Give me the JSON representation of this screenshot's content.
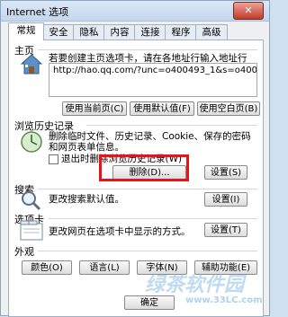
{
  "window": {
    "title": "Internet 选项",
    "close_label": "✕"
  },
  "tabs": [
    "常规",
    "安全",
    "隐私",
    "内容",
    "连接",
    "程序",
    "高级"
  ],
  "homepage": {
    "section_title": "主页",
    "description": "若要创建主页选项卡，请在各地址行输入地址行(R)。",
    "url": "http://hao.qq.com/?unc=o400493_1&s=o40049",
    "buttons": {
      "use_current": "使用当前页(C)",
      "use_default": "使用默认值(F)",
      "use_blank": "使用空白页(B)"
    }
  },
  "history": {
    "section_title": "浏览历史记录",
    "description": "删除临时文件、历史记录、Cookie、保存的密码和网页表单信息。",
    "checkbox_label": "退出时删除浏览历史记录(W)",
    "buttons": {
      "delete": "删除(D)...",
      "settings": "设置(S)"
    }
  },
  "search": {
    "section_title": "搜索",
    "description": "更改搜索默认值。",
    "buttons": {
      "settings": "设置(I)"
    }
  },
  "tabs_section": {
    "section_title": "选项卡",
    "description": "更改网页在选项卡中显示的方式。",
    "buttons": {
      "settings": "设置(T)"
    }
  },
  "appearance": {
    "section_title": "外观",
    "buttons": {
      "colors": "颜色(O)",
      "languages": "语言(L)",
      "fonts": "字体(N)",
      "accessibility": "辅助功能(E)"
    }
  },
  "footer": {
    "ok": "确定"
  },
  "watermark": {
    "text": "绿茶软件园",
    "site": "www.33LC.com"
  }
}
